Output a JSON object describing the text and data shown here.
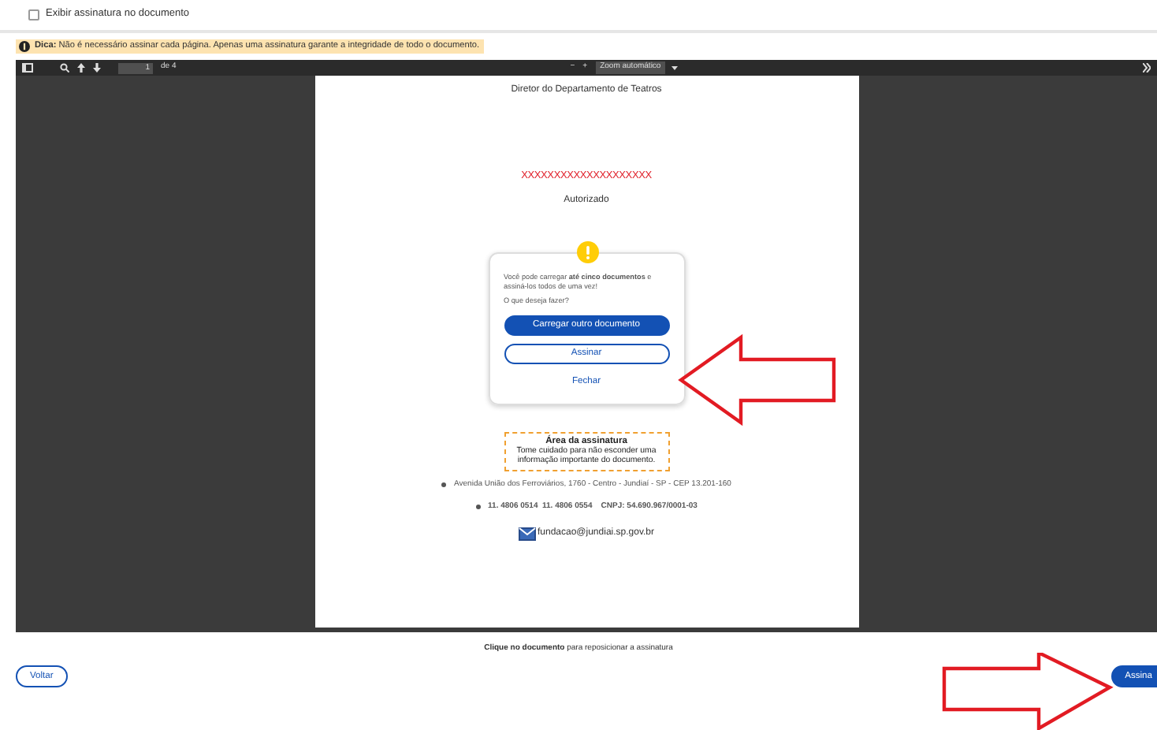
{
  "display_option": {
    "label": "Exibir assinatura no documento",
    "checked": false
  },
  "tip": {
    "text": "**Dica:** Não é necessário assinar cada página. Apenas uma assinatura garante a integridade de todo o documento."
  },
  "viewer": {
    "toolbar": {
      "page": "1",
      "page_count": "de 4",
      "zoom_out": "−",
      "zoom_in": "+",
      "zoom": "Zoom automático"
    },
    "document": {
      "heading": "Diretor do Departamento de Teatros",
      "redacted": "XXXXXXXXXXXXXXXXXXXX",
      "status": "Autorizado",
      "dialog": {
        "text": "Você pode carregar **até cinco documentos** e assiná-los todos de uma vez!",
        "question": "O que deseja fazer?",
        "actions": [
          {
            "label": "Carregar outro documento",
            "kind": "primary"
          },
          {
            "label": "Assinar",
            "kind": "outline"
          },
          {
            "label": "Fechar",
            "kind": "link"
          }
        ]
      },
      "signature_area": {
        "title": "Área da assinatura",
        "text": "Tome cuidado para não esconder uma informação importante do documento."
      },
      "footer_lines": [
        "Avenida União dos Ferroviários, 1760 - Centro - Jundiaí - SP - CEP 13.201-160",
        "11. 4806 0514  11. 4806 0554    CNPJ: 54.690.967/0001-03"
      ],
      "email": "fundacao@jundiai.sp.gov.br"
    }
  },
  "hint": "**Clique no documento** para reposicionar a assinatura",
  "buttons": [
    {
      "label": "Voltar",
      "kind": "outline"
    },
    {
      "label": "Assina",
      "kind": "primary"
    }
  ]
}
